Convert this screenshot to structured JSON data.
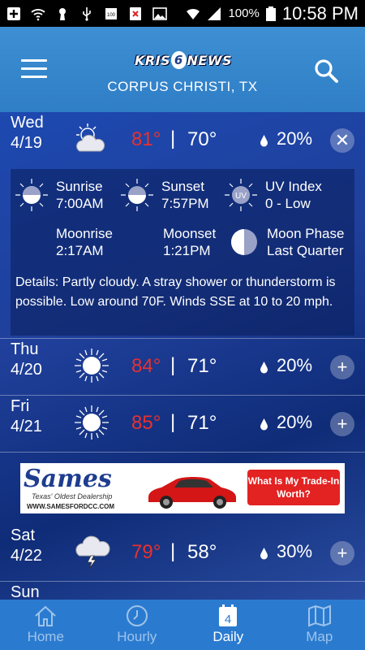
{
  "status_bar": {
    "battery_pct": "100%",
    "time": "10:58 PM",
    "battery_small": "100"
  },
  "header": {
    "logo_left": "KRIS",
    "logo_num": "6",
    "logo_right": "NEWS",
    "city": "CORPUS CHRISTI, TX"
  },
  "days": [
    {
      "name": "Wed",
      "date": "4/19",
      "hi": "81°",
      "sep": "|",
      "lo": "70°",
      "pop": "20%",
      "toggle": "✕",
      "icon": "partly-cloudy-night-icon"
    },
    {
      "name": "Thu",
      "date": "4/20",
      "hi": "84°",
      "sep": "|",
      "lo": "71°",
      "pop": "20%",
      "toggle": "+",
      "icon": "sunny-icon"
    },
    {
      "name": "Fri",
      "date": "4/21",
      "hi": "85°",
      "sep": "|",
      "lo": "71°",
      "pop": "20%",
      "toggle": "+",
      "icon": "sunny-icon"
    },
    {
      "name": "Sat",
      "date": "4/22",
      "hi": "79°",
      "sep": "|",
      "lo": "58°",
      "pop": "30%",
      "toggle": "+",
      "icon": "thunderstorm-icon"
    },
    {
      "name": "Sun"
    }
  ],
  "detail": {
    "sunrise_label": "Sunrise",
    "sunrise_value": "7:00AM",
    "sunset_label": "Sunset",
    "sunset_value": "7:57PM",
    "uv_label": "UV Index",
    "uv_value": "0 - Low",
    "uv_icon_text": "UV",
    "moonrise_label": "Moonrise",
    "moonrise_value": "2:17AM",
    "moonset_label": "Moonset",
    "moonset_value": "1:21PM",
    "moonphase_label": "Moon Phase",
    "moonphase_value": "Last Quarter",
    "text": "Details: Partly cloudy. A stray shower or thunderstorm is possible. Low around 70F. Winds SSE at 10 to 20 mph."
  },
  "ad": {
    "brand": "Sames",
    "tagline": "Texas' Oldest Dealership",
    "url": "WWW.SAMESFORDCC.COM",
    "cta": "What Is My Trade-In Worth?"
  },
  "bottom_nav": [
    {
      "label": "Home",
      "icon": "home-icon"
    },
    {
      "label": "Hourly",
      "icon": "clock-icon"
    },
    {
      "label": "Daily",
      "icon": "calendar-icon",
      "badge": "4",
      "active": true
    },
    {
      "label": "Map",
      "icon": "map-icon"
    }
  ],
  "colors": {
    "header": "#3e8fd3",
    "high_temp": "#e8312e",
    "nav_bg": "#2a7bd0",
    "ad_button": "#e32222"
  }
}
